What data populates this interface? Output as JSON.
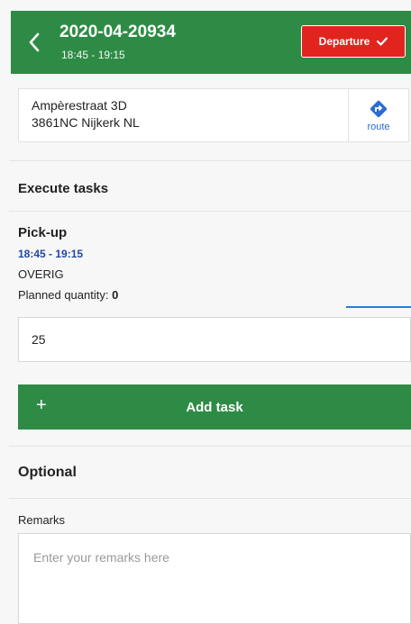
{
  "header": {
    "order_number": "2020-04-20934",
    "time_window": "18:45 - 19:15",
    "departure_label": "Departure",
    "back_icon": "chevron-left-icon",
    "check_icon": "check-icon",
    "background_color": "#2e8b45",
    "departure_color": "#e2241f"
  },
  "address": {
    "line1": "Ampèrestraat 3D",
    "line2": "3861NC Nijkerk NL",
    "route_label": "route",
    "route_icon": "route-direction-icon",
    "route_icon_color": "#2c6cd0"
  },
  "execute_tasks": {
    "title": "Execute tasks",
    "task": {
      "name": "Pick-up",
      "time": "18:45 - 19:15",
      "type": "OVERIG",
      "planned_label": "Planned quantity:",
      "planned_value": "0",
      "quantity_value": "25"
    },
    "add_task_label": "Add task",
    "add_icon": "plus-icon"
  },
  "optional": {
    "title": "Optional",
    "remarks_label": "Remarks",
    "remarks_placeholder": "Enter your remarks here"
  }
}
